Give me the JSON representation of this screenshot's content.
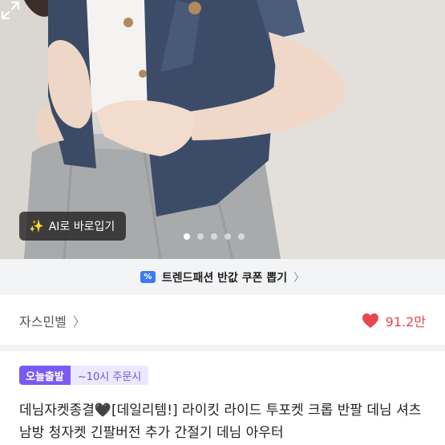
{
  "hero": {
    "ai_button_label": "AI로 바로입기",
    "slides_total": 5,
    "slide_active": 1
  },
  "coupon_banner": {
    "label": "트렌드패션 반값 쿠폰 뽑기",
    "icon": "ticket-icon"
  },
  "seller": {
    "name": "자스민벨",
    "likes": "91.2만"
  },
  "badges": {
    "today_shipping": "오늘출발",
    "order_deadline": "~10시 주문시"
  },
  "product": {
    "title": "데님자켓종결🖤[데일리템!] 라이킷 라이드 투포켓 크롭 반팔 데님 셔츠 남방 청자켓 긴팔버전 추가 간절기 데님 아우터"
  },
  "colors": {
    "accent_purple": "#7a5af5",
    "heart_red": "#e8474f",
    "coupon_blue": "#3b7cf5"
  }
}
